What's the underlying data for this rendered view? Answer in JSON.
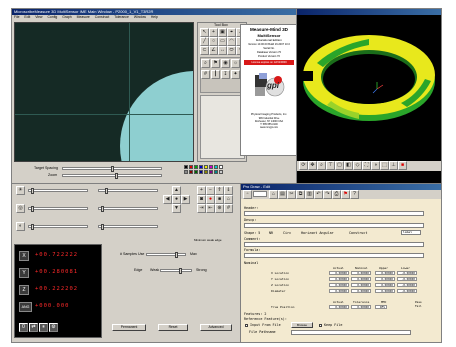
{
  "main_window": {
    "title": "MicroscribeMeasure 3D MultiSensor IME Main Window - P2000_1_V1_T3R2R",
    "menu": [
      "File",
      "Edit",
      "View",
      "Config",
      "Graph",
      "Measure",
      "Construct",
      "Tolerance",
      "Window",
      "Help"
    ]
  },
  "toolbox": {
    "title": "Tool Box"
  },
  "focus": {
    "target_spacing_label": "Target Spacing",
    "zoom_label": "Zoom"
  },
  "about": {
    "product": "Measure-Mind 3D",
    "edition": "MultiSensor",
    "subtitle": "Educational Edition",
    "lines": [
      "Version 10.00.00 Build 16.2007 10.0",
      "Serial No.",
      "Database Version 70",
      "Product Version 70"
    ],
    "expire_notice": "License expires on 12/31/0000",
    "logo_text": "gpi",
    "company": "Physical Imaging Products, Inc.",
    "address": [
      "999 Industrial Drive",
      "Rochester, NY 14600 USA",
      "T: 585-555-0100",
      "www.mmgpi.com"
    ]
  },
  "dro": {
    "rows": [
      {
        "axis": "X",
        "value": "+00.722222"
      },
      {
        "axis": "Y",
        "value": "+00.280081"
      },
      {
        "axis": "Z",
        "value": "+00.222202"
      },
      {
        "axis": "ANG",
        "value": "+000.000"
      }
    ]
  },
  "edge_controls": {
    "min_edge_label": "Minimum weak edge",
    "samples_label": "# Samples Use",
    "max_label": "Max",
    "edge_label": "Edge",
    "weak_label": "Weak",
    "strong_label": "Strong",
    "buttons": [
      "Permanent",
      "Reset",
      "Advanced"
    ]
  },
  "feature_form": {
    "title": "Pro Draw - Edit",
    "fields": [
      {
        "label": "Header:",
        "value": ""
      },
      {
        "label": "Descp:",
        "value": ""
      }
    ],
    "shape_row": {
      "label": "Shape: 5",
      "items": [
        "NR",
        "Circ",
        "Horizont Angular",
        "Construct"
      ],
      "select": "label"
    },
    "comment_label": "Comment:",
    "formula_label": "Formula:",
    "nominal_label": "Nominal",
    "columns": [
      "Actual",
      "Nominal",
      "Upper",
      "Lower"
    ],
    "rows": [
      {
        "label": "X Location",
        "values": [
          "0.00000",
          "0.00000",
          "0.00000",
          "-0.00000"
        ]
      },
      {
        "label": "Y Location",
        "values": [
          "0.00000",
          "0.00000",
          "0.00000",
          "-0.00000"
        ]
      },
      {
        "label": "Z Location",
        "values": [
          "0.00000",
          "0.00000",
          "0.00000",
          "-0.00000"
        ]
      },
      {
        "label": "Diameter",
        "values": [
          "0.00000",
          "0.00000",
          "0.00000",
          "-0.00000"
        ]
      }
    ],
    "pos_columns": [
      "Actual",
      "Tolerance",
      "MMC"
    ],
    "true_position": {
      "label": "True Position",
      "values": [
        "0.00000",
        "0.00000",
        "RFS"
      ]
    },
    "features_label": "Features: 2",
    "reference_label": "Reference Feature(s):",
    "input_label": "Input From File",
    "browse_label": "Browse",
    "keep_label": "Keep File",
    "filename_label": "File Pathname",
    "pass_label": "Pass",
    "fail_label": "Fail"
  },
  "colors": {
    "part_yellow": "#e8e81c",
    "part_green": "#2aa52a",
    "video_blue": "#8ecfd0",
    "dro_red": "#ff2a2a"
  }
}
